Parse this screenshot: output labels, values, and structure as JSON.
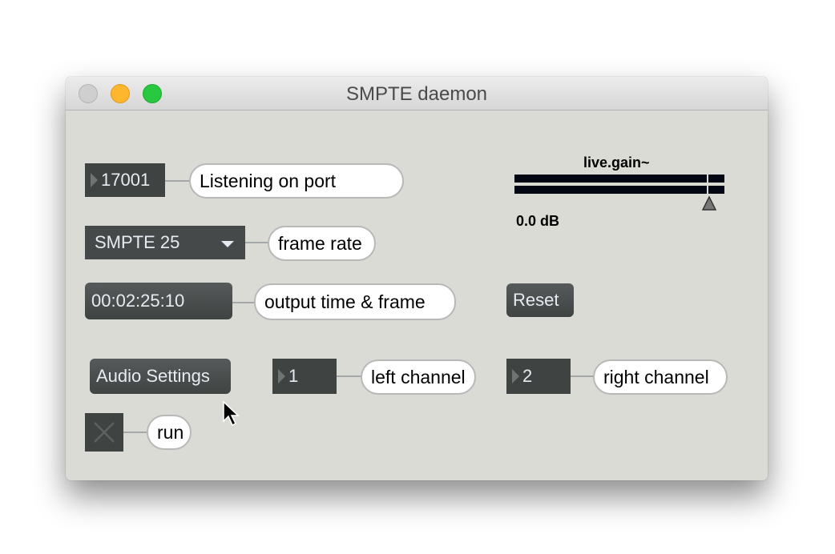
{
  "window": {
    "title": "SMPTE daemon",
    "traffic_lights": {
      "close": "#cfcfcf",
      "minimize": "#fdb62d",
      "maximize": "#28c840"
    }
  },
  "port": {
    "value": "17001",
    "comment": "Listening on port"
  },
  "frame_rate": {
    "selected": "SMPTE 25",
    "comment": "frame rate"
  },
  "time_output": {
    "value": "00:02:25:10",
    "comment": "output time & frame"
  },
  "reset": {
    "label": "Reset"
  },
  "gain": {
    "title": "live.gain~",
    "value_label": "0.0 dB",
    "value_db": 0.0
  },
  "audio_settings": {
    "label": "Audio Settings"
  },
  "left_channel": {
    "value": "1",
    "comment": "left channel"
  },
  "right_channel": {
    "value": "2",
    "comment": "right channel"
  },
  "run": {
    "comment": "run",
    "checked": false
  },
  "colors": {
    "patch_bg": "#dbdbd5",
    "object_bg": "#3f4443",
    "meter": "#030714"
  }
}
